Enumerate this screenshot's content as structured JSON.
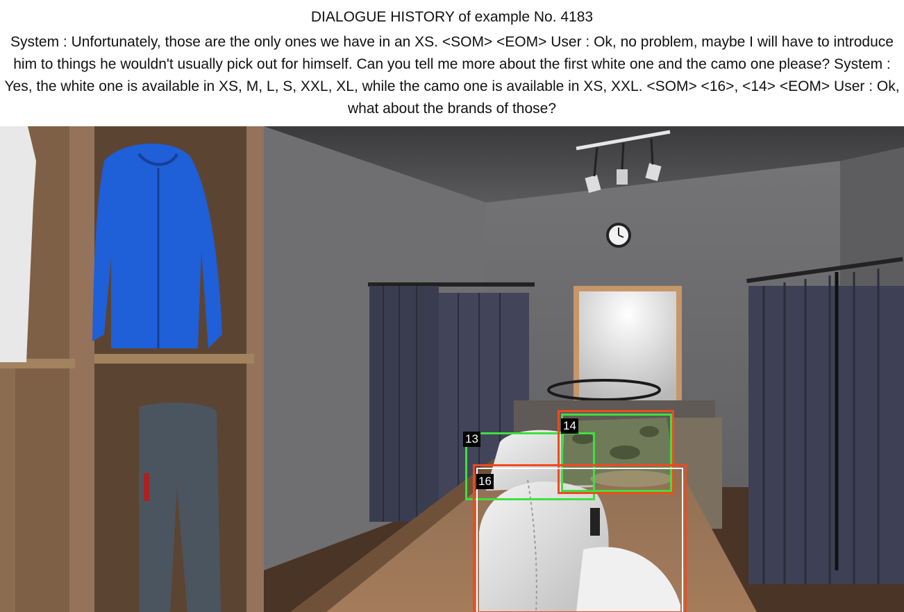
{
  "header": {
    "title": "DIALOGUE HISTORY of example No. 4183",
    "dialogue": "System : Unfortunately, those are the only ones we have in an XS. <SOM>  <EOM> User : Ok, no problem, maybe I will have to introduce him to things he wouldn't usually pick out for himself. Can you tell me more about the first white one and the camo one please? System : Yes, the white one is available in XS, M, L, S, XXL, XL, while the camo one is available in XS, XXL. <SOM> <16>, <14> <EOM> User : Ok, what about the brands of those?"
  },
  "annotations": [
    {
      "id": "13",
      "color": "#3ee03e"
    },
    {
      "id": "14",
      "color": "#3ee03e"
    },
    {
      "id": "16",
      "color": "#f04a1e"
    }
  ],
  "colors": {
    "wall": "#6d6d6f",
    "shelf_wood": "#8a6a4c",
    "table_wood": "#9b7456",
    "curtain": "#3c3f52",
    "jacket": "#1f5fd8"
  }
}
